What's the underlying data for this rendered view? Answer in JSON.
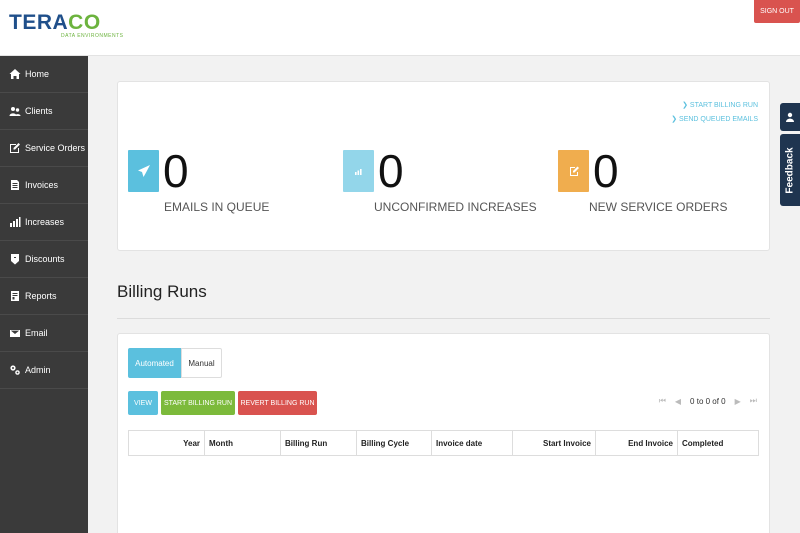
{
  "header": {
    "logo_prefix": "TERA",
    "logo_suffix": "CO",
    "logo_sub": "DATA ENVIRONMENTS",
    "signout_label": "SIGN OUT"
  },
  "sidebar": {
    "items": [
      {
        "label": "Home",
        "icon": "home-icon"
      },
      {
        "label": "Clients",
        "icon": "users-icon"
      },
      {
        "label": "Service Orders",
        "icon": "edit-icon"
      },
      {
        "label": "Invoices",
        "icon": "document-icon"
      },
      {
        "label": "Increases",
        "icon": "bar-chart-icon"
      },
      {
        "label": "Discounts",
        "icon": "tag-icon"
      },
      {
        "label": "Reports",
        "icon": "report-icon"
      },
      {
        "label": "Email",
        "icon": "envelope-icon"
      },
      {
        "label": "Admin",
        "icon": "cogs-icon"
      }
    ]
  },
  "dashboard": {
    "links": {
      "start_billing_run": "START BILLING RUN",
      "send_queued_emails": "SEND QUEUED EMAILS"
    },
    "stats": [
      {
        "value": "0",
        "label": "EMAILS IN QUEUE",
        "icon": "paper-plane-icon",
        "color": "#5bc0de"
      },
      {
        "value": "0",
        "label": "UNCONFIRMED INCREASES",
        "icon": "bar-chart-icon",
        "color": "#93d6ea"
      },
      {
        "value": "0",
        "label": "NEW SERVICE ORDERS",
        "icon": "edit-icon",
        "color": "#f0ad4e"
      }
    ]
  },
  "billing": {
    "title": "Billing Runs",
    "tabs": {
      "automated": "Automated",
      "manual": "Manual"
    },
    "buttons": {
      "view": "VIEW",
      "start": "START BILLING RUN",
      "revert": "REVERT BILLING RUN"
    },
    "pager_text": "0 to 0 of 0",
    "columns": [
      "Year",
      "Month",
      "Billing Run",
      "Billing Cycle",
      "Invoice date",
      "Start Invoice",
      "End Invoice",
      "Completed"
    ]
  },
  "side_tabs": {
    "feedback": "Feedback"
  },
  "colors": {
    "accent": "#5bc0de",
    "success": "#7cba3b",
    "danger": "#d9534f",
    "warning": "#f0ad4e",
    "sidebar": "#3a3a3a",
    "brand": "#1f4f8a"
  }
}
